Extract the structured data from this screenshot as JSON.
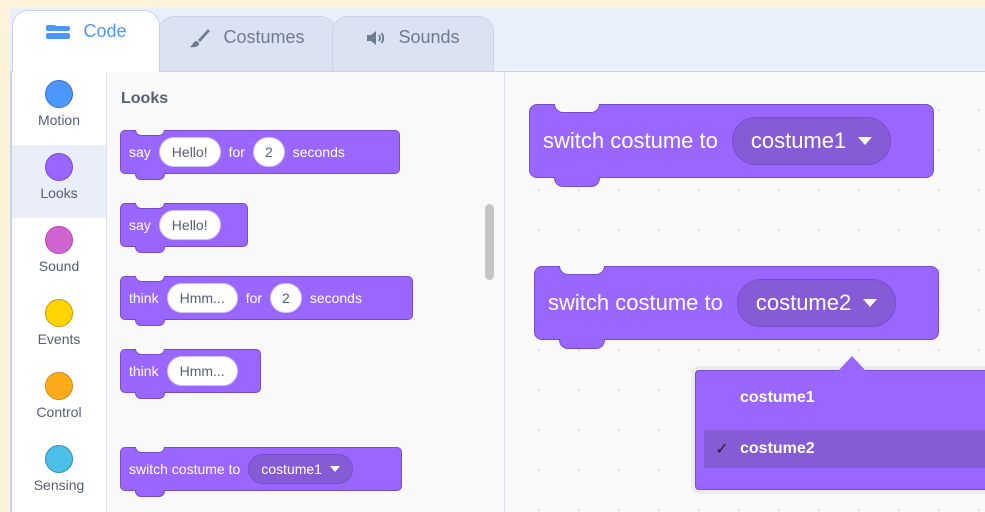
{
  "tabs": [
    {
      "label": "Code",
      "icon": "code-icon",
      "active": true
    },
    {
      "label": "Costumes",
      "icon": "brush-icon",
      "active": false
    },
    {
      "label": "Sounds",
      "icon": "speaker-icon",
      "active": false
    }
  ],
  "categories": [
    {
      "label": "Motion",
      "color": "#4c97ff"
    },
    {
      "label": "Looks",
      "color": "#9966ff",
      "active": true
    },
    {
      "label": "Sound",
      "color": "#cf63cf"
    },
    {
      "label": "Events",
      "color": "#ffd500"
    },
    {
      "label": "Control",
      "color": "#ffab19"
    },
    {
      "label": "Sensing",
      "color": "#4cbfe6"
    }
  ],
  "palette": {
    "title": "Looks",
    "blocks": [
      {
        "parts": [
          "say",
          "Hello!",
          "for",
          "2",
          "seconds"
        ]
      },
      {
        "parts": [
          "say",
          "Hello!"
        ]
      },
      {
        "parts": [
          "think",
          "Hmm...",
          "for",
          "2",
          "seconds"
        ]
      },
      {
        "parts": [
          "think",
          "Hmm..."
        ]
      },
      {
        "parts": [
          "switch costume to",
          "costume1"
        ]
      }
    ]
  },
  "workspace": {
    "blocks": [
      {
        "label": "switch costume to",
        "value": "costume1"
      },
      {
        "label": "switch costume to",
        "value": "costume2"
      }
    ]
  },
  "dropdown": {
    "options": [
      {
        "label": "costume1",
        "selected": false
      },
      {
        "label": "costume2",
        "selected": true
      }
    ],
    "check_glyph": "✓"
  },
  "colors": {
    "looks": "#9966ff",
    "looks_dark": "#774dcb",
    "looks_secondary": "#855cd6",
    "accent": "#4c97ff"
  }
}
